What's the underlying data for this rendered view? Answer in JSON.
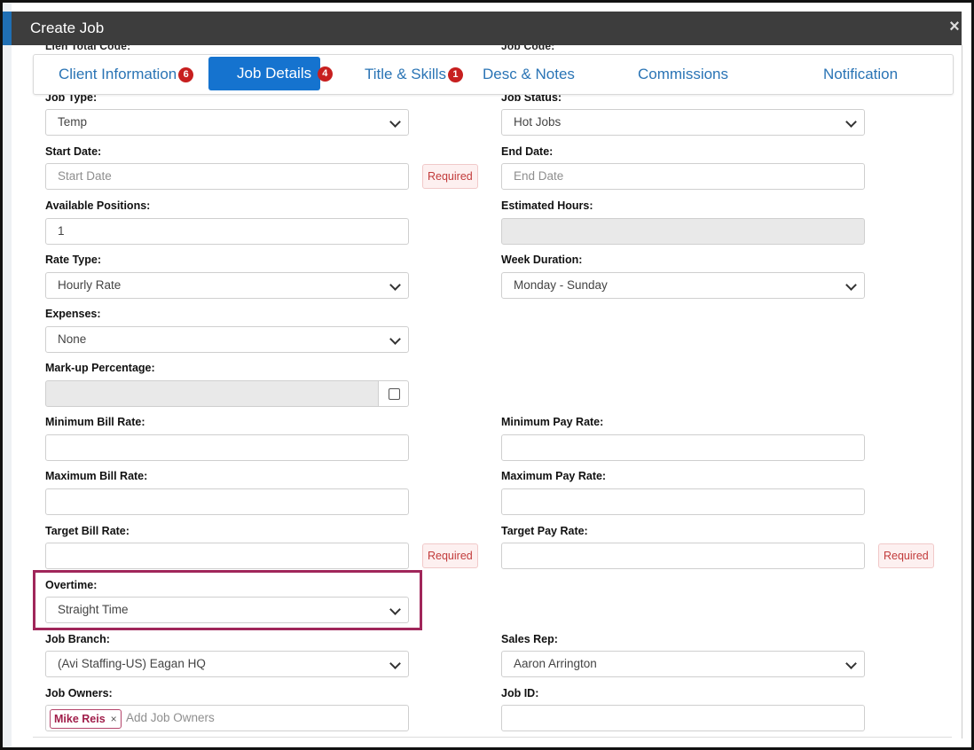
{
  "modal": {
    "title": "Create Job",
    "close": "×"
  },
  "ghost_labels": {
    "left": "Lien Total Code:",
    "right": "Job Code:"
  },
  "tabs": [
    {
      "label": "Client Information",
      "badge": "6"
    },
    {
      "label": "Job Details",
      "badge": "4"
    },
    {
      "label": "Title & Skills",
      "badge": "1"
    },
    {
      "label": "Desc & Notes",
      "badge": ""
    },
    {
      "label": "Commissions",
      "badge": ""
    },
    {
      "label": "Notification",
      "badge": ""
    }
  ],
  "fields": {
    "job_type": {
      "label": "Job Type:",
      "value": "Temp"
    },
    "job_status": {
      "label": "Job Status:",
      "value": "Hot Jobs"
    },
    "start_date": {
      "label": "Start Date:",
      "placeholder": "Start Date",
      "required": "Required"
    },
    "end_date": {
      "label": "End Date:",
      "placeholder": "End Date"
    },
    "available_positions": {
      "label": "Available Positions:",
      "value": "1"
    },
    "estimated_hours": {
      "label": "Estimated Hours:",
      "value": ""
    },
    "rate_type": {
      "label": "Rate Type:",
      "value": "Hourly Rate"
    },
    "week_duration": {
      "label": "Week Duration:",
      "value": "Monday - Sunday"
    },
    "expenses": {
      "label": "Expenses:",
      "value": "None"
    },
    "markup": {
      "label": "Mark-up Percentage:",
      "value": ""
    },
    "min_bill": {
      "label": "Minimum Bill Rate:",
      "value": ""
    },
    "min_pay": {
      "label": "Minimum Pay Rate:",
      "value": ""
    },
    "max_bill": {
      "label": "Maximum Bill Rate:",
      "value": ""
    },
    "max_pay": {
      "label": "Maximum Pay Rate:",
      "value": ""
    },
    "target_bill": {
      "label": "Target Bill Rate:",
      "value": "",
      "required": "Required"
    },
    "target_pay": {
      "label": "Target Pay Rate:",
      "value": "",
      "required": "Required"
    },
    "overtime": {
      "label": "Overtime:",
      "value": "Straight Time"
    },
    "job_branch": {
      "label": "Job Branch:",
      "value": "(Avi Staffing-US) Eagan HQ"
    },
    "sales_rep": {
      "label": "Sales Rep:",
      "value": "Aaron Arrington"
    },
    "job_owners": {
      "label": "Job Owners:",
      "tag": "Mike Reis",
      "tag_remove": "×",
      "placeholder": "Add Job Owners"
    },
    "job_id": {
      "label": "Job ID:",
      "value": ""
    }
  },
  "colors": {
    "header": "#3d3d3d",
    "tab_active": "#1573cf",
    "tab_text": "#2a74b5",
    "badge": "#c71f1f",
    "highlight": "#a0265a",
    "required_text": "#c23b3b"
  }
}
